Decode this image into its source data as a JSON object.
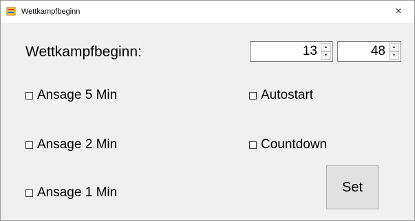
{
  "window": {
    "title": "Wettkampfbeginn",
    "close_symbol": "×",
    "icon": "stopwatch-icon"
  },
  "form": {
    "start_label": "Wettkampfbeginn:",
    "hour_value": "13",
    "minute_value": "48",
    "spin_up_symbol": "▲",
    "spin_down_symbol": "▼",
    "checkboxes_left": [
      {
        "label": "Ansage 5 Min",
        "checked": false
      },
      {
        "label": "Ansage 2 Min",
        "checked": false
      },
      {
        "label": "Ansage 1 Min",
        "checked": false
      }
    ],
    "checkboxes_right": [
      {
        "label": "Autostart",
        "checked": false
      },
      {
        "label": "Countdown",
        "checked": false
      }
    ],
    "set_label": "Set"
  },
  "colors": {
    "window_bg": "#f0f0f0",
    "titlebar_bg": "#ffffff",
    "button_bg": "#e1e1e1"
  }
}
